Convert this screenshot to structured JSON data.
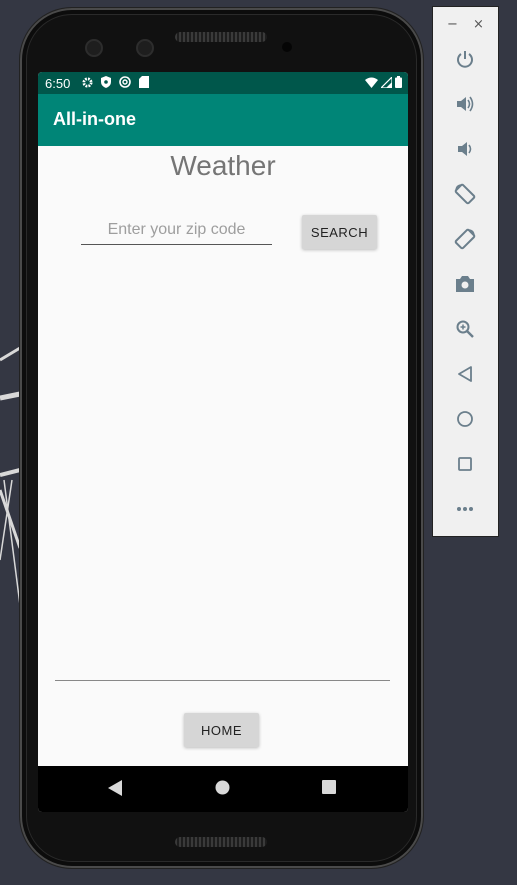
{
  "status_bar": {
    "time": "6:50",
    "icons": [
      "gear-icon",
      "shield-icon",
      "sync-icon",
      "sd-card-icon"
    ],
    "right_icons": [
      "wifi-icon",
      "signal-icon",
      "battery-icon"
    ]
  },
  "app_bar": {
    "title": "All-in-one"
  },
  "weather": {
    "title": "Weather",
    "zip_placeholder": "Enter your zip code",
    "zip_value": "",
    "search_label": "SEARCH"
  },
  "footer": {
    "home_label": "HOME"
  },
  "colors": {
    "status_bar": "#00574b",
    "app_bar": "#008577",
    "screen_bg": "#fafafa",
    "button_bg": "#d6d6d6",
    "desktop_bg": "#343743"
  },
  "emulator_panel": {
    "window_controls": {
      "minimize": "−",
      "close": "×"
    },
    "tools": [
      "power-icon",
      "volume-up-icon",
      "volume-down-icon",
      "rotate-left-icon",
      "rotate-right-icon",
      "camera-icon",
      "zoom-icon",
      "back-icon",
      "home-icon",
      "overview-icon",
      "more-icon"
    ]
  }
}
